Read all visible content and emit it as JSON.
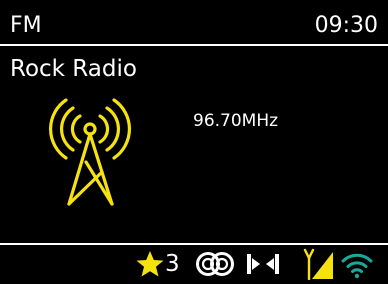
{
  "header": {
    "mode": "FM",
    "time": "09:30"
  },
  "station": {
    "name": "Rock Radio",
    "frequency": "96.70MHz"
  },
  "status_bar": {
    "preset_number": "3",
    "icons": [
      "star-icon",
      "stereo-icon",
      "mute-icon",
      "signal-strength-icon",
      "wifi-icon"
    ]
  },
  "colors": {
    "background": "#000000",
    "text": "#ffffff",
    "accent_yellow": "#f5e20f",
    "wifi_teal": "#1aa898"
  }
}
